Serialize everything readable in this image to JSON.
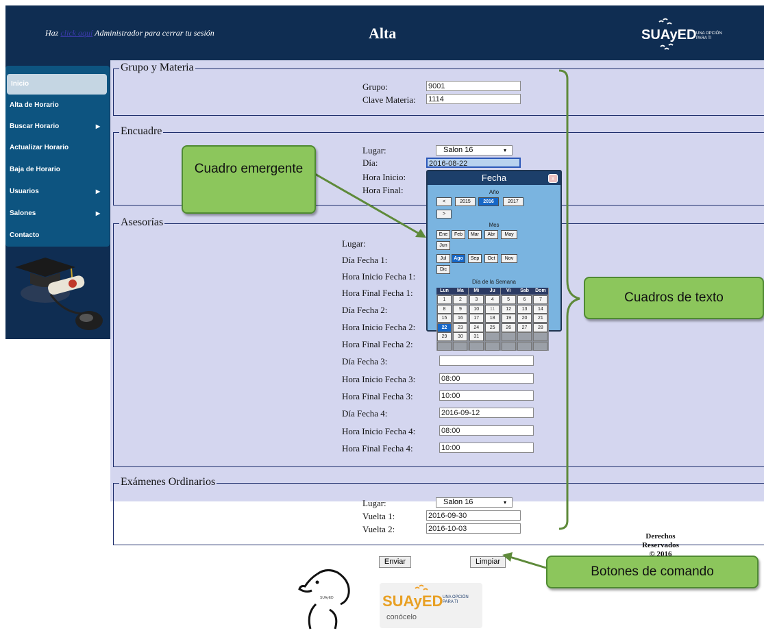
{
  "header": {
    "logout_prefix": "Haz",
    "logout_link": "click aquí",
    "logout_suffix": "Administrador para cerrar tu sesión",
    "title": "Alta",
    "logo_brand": "SUAyED",
    "logo_tagline": "UNA OPCIÓN PARA TI"
  },
  "sidebar": {
    "items": [
      {
        "label": "Inicio",
        "arrow": ""
      },
      {
        "label": "Alta de Horario",
        "arrow": ""
      },
      {
        "label": "Buscar Horario",
        "arrow": "▶"
      },
      {
        "label": "Actualizar Horario",
        "arrow": ""
      },
      {
        "label": "Baja de Horario",
        "arrow": ""
      },
      {
        "label": "Usuarios",
        "arrow": "▶"
      },
      {
        "label": "Salones",
        "arrow": "▶"
      },
      {
        "label": "Contacto",
        "arrow": ""
      }
    ]
  },
  "grupo": {
    "legend": "Grupo y Materia",
    "grupo_label": "Grupo:",
    "grupo_value": "9001",
    "clave_label": "Clave Materia:",
    "clave_value": "1114"
  },
  "encuadre": {
    "legend": "Encuadre",
    "lugar_label": "Lugar:",
    "lugar_value": "Salon 16",
    "dia_label": "Día:",
    "dia_value": "2016-08-22",
    "hora_inicio_label": "Hora Inicio:",
    "hora_final_label": "Hora Final:"
  },
  "asesorias": {
    "legend": "Asesorías",
    "labels": [
      "Lugar:",
      "Día Fecha 1:",
      "Hora Inicio Fecha 1:",
      "Hora Final Fecha 1:",
      "Día Fecha 2:",
      "Hora Inicio Fecha 2:",
      "Hora Final Fecha 2:",
      "Día Fecha 3:",
      "Hora Inicio Fecha 3:",
      "Hora Final Fecha 3:",
      "Día Fecha 4:",
      "Hora Inicio Fecha 4:",
      "Hora Final Fecha 4:"
    ],
    "values": [
      "",
      "",
      "",
      "",
      "",
      "",
      "",
      "",
      "08:00",
      "10:00",
      "2016-09-12",
      "08:00",
      "10:00"
    ]
  },
  "examenes": {
    "legend": "Exámenes Ordinarios",
    "lugar_label": "Lugar:",
    "lugar_value": "Salon 16",
    "vuelta1_label": "Vuelta 1:",
    "vuelta1_value": "2016-09-30",
    "vuelta2_label": "Vuelta 2:",
    "vuelta2_value": "2016-10-03"
  },
  "buttons": {
    "enviar": "Enviar",
    "limpiar": "Limpiar"
  },
  "calendar": {
    "title": "Fecha",
    "close": "x",
    "year_label": "Año",
    "prev": "<",
    "next": ">",
    "years": [
      "2015",
      "2016",
      "2017"
    ],
    "selected_year": "2016",
    "month_label": "Mes",
    "months": [
      "Ene",
      "Feb",
      "Mar",
      "Abr",
      "May",
      "Jun",
      "Jul",
      "Ago",
      "Sep",
      "Oct",
      "Nov",
      "Dic"
    ],
    "selected_month": "Ago",
    "weekday_label": "Día de la Semana",
    "weekdays": [
      "Lun",
      "Ma",
      "Mi",
      "Ju",
      "Vi",
      "Sab",
      "Dom"
    ],
    "days": [
      "1",
      "2",
      "3",
      "4",
      "5",
      "6",
      "7",
      "8",
      "9",
      "10",
      "11",
      "12",
      "13",
      "14",
      "15",
      "16",
      "17",
      "18",
      "19",
      "20",
      "21",
      "22",
      "23",
      "24",
      "25",
      "26",
      "27",
      "28",
      "29",
      "30",
      "31"
    ],
    "selected_day": "22",
    "dimmed_day": "11"
  },
  "callouts": {
    "popup": "Cuadro emergente",
    "textboxes": "Cuadros de texto",
    "commands": "Botones de comando"
  },
  "footer": {
    "logo_brand": "SUAyED",
    "logo_tagline": "UNA OPCIÓN PARA TI",
    "logo_sub": "conócelo",
    "rights_line1": "Derechos",
    "rights_line2": "Reservados",
    "rights_line3": "© 2016"
  },
  "colors": {
    "header_bg": "#0f2d52",
    "form_bg": "#d4d6ef",
    "menu_bg": "#0d5480",
    "callout_green": "#8cc65c",
    "calendar_blue": "#7ab4e0",
    "selected_blue": "#1567c8"
  }
}
